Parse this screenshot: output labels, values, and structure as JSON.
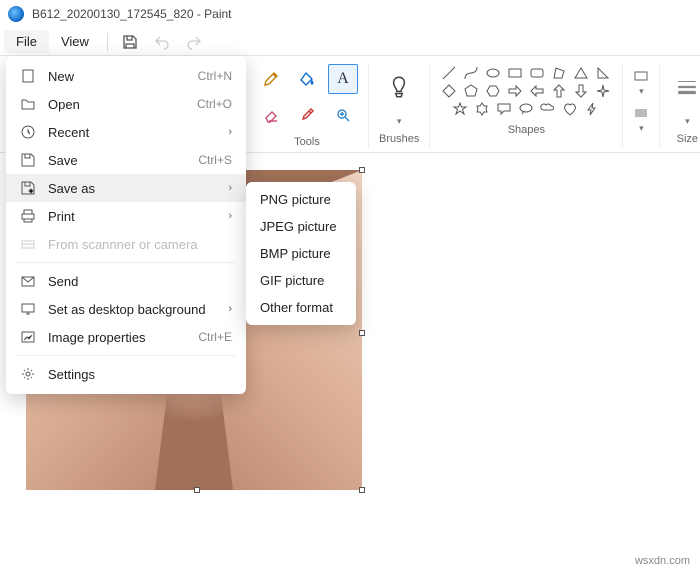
{
  "title": "B612_20200130_172545_820 - Paint",
  "menubar": {
    "file": "File",
    "view": "View"
  },
  "ribbon": {
    "tools": {
      "label": "Tools",
      "items": [
        "pencil",
        "bucket",
        "text",
        "eraser",
        "picker",
        "zoom"
      ]
    },
    "brushes": {
      "label": "Brushes"
    },
    "shapes": {
      "label": "Shapes"
    },
    "size": {
      "label": "Size"
    }
  },
  "file_menu": {
    "new": {
      "label": "New",
      "accel": "Ctrl+N"
    },
    "open": {
      "label": "Open",
      "accel": "Ctrl+O"
    },
    "recent": {
      "label": "Recent"
    },
    "save": {
      "label": "Save",
      "accel": "Ctrl+S"
    },
    "saveas": {
      "label": "Save as"
    },
    "print": {
      "label": "Print"
    },
    "scanner": {
      "label": "From scannner or camera"
    },
    "send": {
      "label": "Send"
    },
    "setbg": {
      "label": "Set as desktop background"
    },
    "props": {
      "label": "Image properties",
      "accel": "Ctrl+E"
    },
    "settings": {
      "label": "Settings"
    }
  },
  "saveas_sub": {
    "png": "PNG picture",
    "jpeg": "JPEG picture",
    "bmp": "BMP picture",
    "gif": "GIF picture",
    "other": "Other format"
  },
  "watermark": "wsxdn.com"
}
